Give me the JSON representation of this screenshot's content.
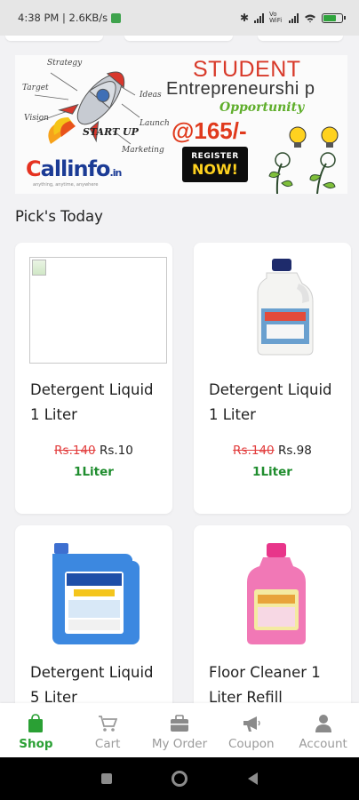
{
  "status_bar": {
    "time_speed": "4:38 PM | 2.6KB/s",
    "network": "Vo WiFi",
    "battery_level": 0.7,
    "colors": {
      "notification": "#3fa34d",
      "battery": "#2fa43d"
    }
  },
  "banner": {
    "doodles": [
      "Strategy",
      "Target",
      "Vision",
      "Ideas",
      "Launch",
      "Marketing"
    ],
    "start_up": "START UP",
    "logo": {
      "c": "C",
      "rest": "allinfo",
      "domain": ".in",
      "tagline": "anything, anytime, anywhere"
    },
    "title_line1": "STUDENT",
    "title_line2": "Entrepreneurshi p",
    "title_line3": "Opportunity",
    "price": "@165/-",
    "register_line1": "REGISTER",
    "register_line2": "NOW!"
  },
  "section": {
    "title": "Pick's Today"
  },
  "products": [
    {
      "name": "Detergent Liquid 1 Liter",
      "old_price": "Rs.140",
      "new_price": "Rs.10",
      "unit": "1Liter",
      "image": "broken-image-icon"
    },
    {
      "name": "Detergent Liquid 1 Liter",
      "old_price": "Rs.140",
      "new_price": "Rs.98",
      "unit": "1Liter",
      "image": "white-detergent-bottle"
    },
    {
      "name": "Detergent Liquid 5 Liter",
      "old_price": "",
      "new_price": "",
      "unit": "",
      "image": "blue-cleanex-can"
    },
    {
      "name": "Floor Cleaner 1 Liter Refill",
      "old_price": "",
      "new_price": "",
      "unit": "",
      "image": "pink-floor-cleaner-bottle"
    }
  ],
  "bottom_nav": {
    "active_color": "#2aa034",
    "items": [
      {
        "label": "Shop",
        "icon": "shopping-bag-icon"
      },
      {
        "label": "Cart",
        "icon": "cart-icon"
      },
      {
        "label": "My Order",
        "icon": "briefcase-icon"
      },
      {
        "label": "Coupon",
        "icon": "megaphone-icon"
      },
      {
        "label": "Account",
        "icon": "person-icon"
      }
    ]
  },
  "system_nav": {
    "icons": [
      "recents-square-icon",
      "home-circle-icon",
      "back-triangle-icon"
    ]
  }
}
